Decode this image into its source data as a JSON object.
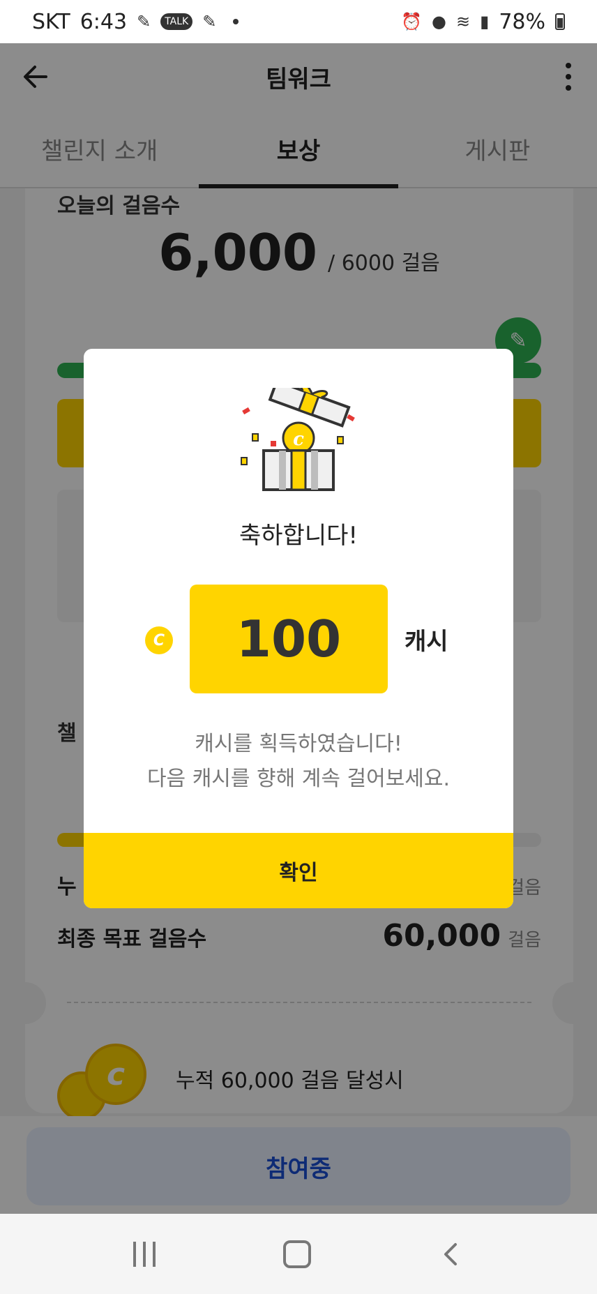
{
  "status_bar": {
    "carrier": "SKT",
    "time": "6:43",
    "talk": "TALK",
    "battery": "78%"
  },
  "header": {
    "title": "팀워크"
  },
  "tabs": [
    {
      "label": "챌린지 소개"
    },
    {
      "label": "보상"
    },
    {
      "label": "게시판"
    }
  ],
  "today_card": {
    "label": "오늘의 걸음수",
    "steps": "6,000",
    "goal": "/ 6000 걸음"
  },
  "challenge_card": {
    "title": "챌",
    "cumulative_label": "누",
    "cumulative_unit": "걸음",
    "final_goal_label": "최종 목표 걸음수",
    "final_goal_value": "60,000",
    "final_goal_unit": "걸음",
    "reward_text": "누적 60,000 걸음 달성시"
  },
  "join_button": {
    "label": "참여중"
  },
  "modal": {
    "title": "축하합니다!",
    "coin_symbol": "C",
    "amount": "100",
    "unit": "캐시",
    "message_line1": "캐시를 획득하였습니다!",
    "message_line2": "다음 캐시를 향해 계속 걸어보세요.",
    "confirm_label": "확인"
  },
  "colors": {
    "accent_yellow": "#ffd400",
    "green": "#2eb352",
    "join_blue": "#1a4fd6"
  }
}
